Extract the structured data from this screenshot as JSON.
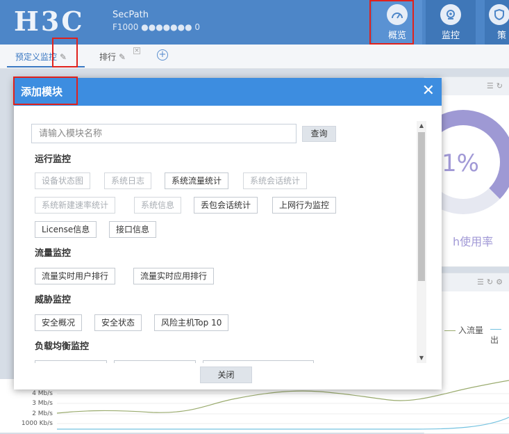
{
  "header": {
    "logo": "H3C",
    "product_name": "SecPath",
    "product_model": "F1000 ●●●●●●● 0",
    "nav": [
      {
        "label": "概览",
        "icon": "speedometer-icon",
        "active": true
      },
      {
        "label": "监控",
        "icon": "camera-icon"
      },
      {
        "label": "策",
        "icon": "shield-icon"
      }
    ]
  },
  "tabs": {
    "items": [
      {
        "label": "预定义监控",
        "active": true
      },
      {
        "label": "排行"
      }
    ]
  },
  "dashboard": {
    "usage_percent_text": "1%",
    "usage_label": "h使用率",
    "legend_in": "入流量",
    "legend_out": "出",
    "y_ticks": [
      "4 Mb/s",
      "3 Mb/s",
      "2 Mb/s",
      "1000 Kb/s"
    ],
    "colors": {
      "in_flow": "#9aab6e",
      "out_flow": "#73c2e0",
      "donut": "#9e99d4"
    }
  },
  "modal": {
    "title": "添加模块",
    "search_placeholder": "请输入模块名称",
    "search_button": "查询",
    "close_button": "关闭",
    "sections": [
      {
        "title": "运行监控",
        "items": [
          {
            "label": "设备状态图",
            "enabled": false
          },
          {
            "label": "系统日志",
            "enabled": false
          },
          {
            "label": "系统流量统计",
            "enabled": true
          },
          {
            "label": "系统会话统计",
            "enabled": false
          },
          {
            "label": "系统新建速率统计",
            "enabled": false
          },
          {
            "label": "系统信息",
            "enabled": false
          },
          {
            "label": "丢包会话统计",
            "enabled": true
          },
          {
            "label": "上网行为监控",
            "enabled": true
          },
          {
            "label": "License信息",
            "enabled": true
          },
          {
            "label": "接口信息",
            "enabled": true
          }
        ]
      },
      {
        "title": "流量监控",
        "items": [
          {
            "label": "流量实时用户排行",
            "enabled": true
          },
          {
            "label": "流量实时应用排行",
            "enabled": true
          }
        ]
      },
      {
        "title": "威胁监控",
        "items": [
          {
            "label": "安全概况",
            "enabled": true
          },
          {
            "label": "安全状态",
            "enabled": true
          },
          {
            "label": "风险主机Top 10",
            "enabled": true
          }
        ]
      },
      {
        "title": "负载均衡监控",
        "items": []
      }
    ]
  }
}
